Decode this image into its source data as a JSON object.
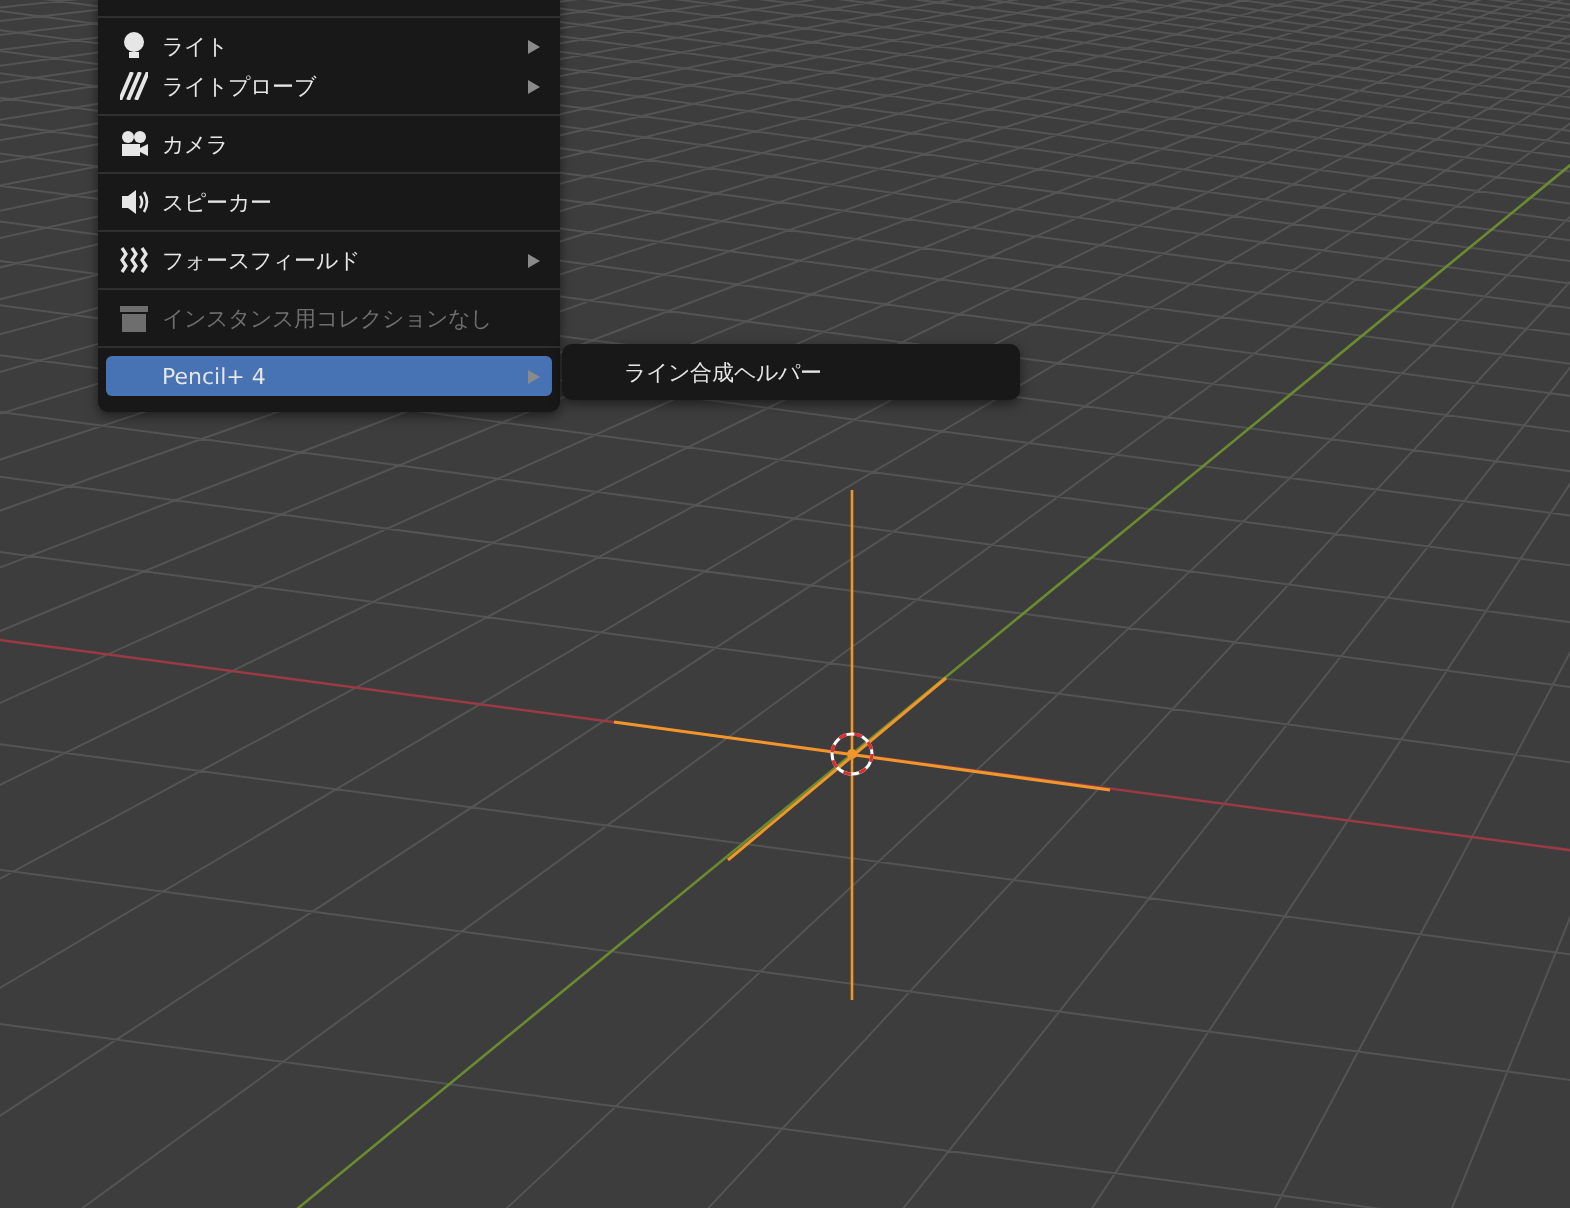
{
  "add_menu": {
    "sections": [
      [
        {
          "label": "ライト",
          "kind": "light",
          "submenu": true,
          "disabled": false,
          "selected": false
        },
        {
          "label": "ライトプローブ",
          "kind": "light_probe",
          "submenu": true,
          "disabled": false,
          "selected": false
        }
      ],
      [
        {
          "label": "カメラ",
          "kind": "camera",
          "submenu": false,
          "disabled": false,
          "selected": false
        }
      ],
      [
        {
          "label": "スピーカー",
          "kind": "speaker",
          "submenu": false,
          "disabled": false,
          "selected": false
        }
      ],
      [
        {
          "label": "フォースフィールド",
          "kind": "force_field",
          "submenu": true,
          "disabled": false,
          "selected": false
        }
      ],
      [
        {
          "label": "インスタンス用コレクションなし",
          "kind": "collection",
          "submenu": false,
          "disabled": true,
          "selected": false
        }
      ],
      [
        {
          "label": "Pencil+ 4",
          "kind": "plain",
          "submenu": true,
          "disabled": false,
          "selected": true
        }
      ]
    ]
  },
  "submenu": {
    "items": [
      {
        "label": "ライン合成ヘルパー"
      }
    ]
  }
}
